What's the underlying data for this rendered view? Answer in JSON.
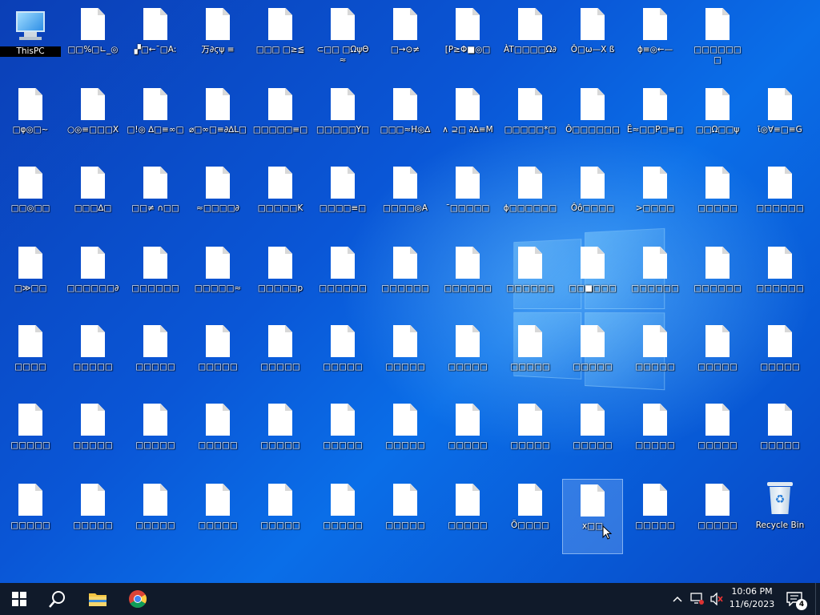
{
  "desktop": {
    "this_pc_label": "ThisPC",
    "recycle_bin_label": "Recycle Bin",
    "file_labels": [
      [
        "□□%□∟_◎",
        "▞□←¯□A:",
        "万∂ϛψ ≡",
        "□□□ □≥≦",
        "⊂□□ □ΩψΘ≈",
        "□→⊙≠",
        "[P≥Φ■◎□",
        "ÀT□□□□Ω∂",
        "Ǒ□ω—X ß",
        "ϕ≡◎←—",
        "□□□□□□ □"
      ],
      [
        "□φ◎□~",
        "○◎≡□□□X",
        "□!◎ ∆□≡∞□",
        "⌀□∞□≡∂∆L□",
        "□□□□□≡□",
        "□□□□□Y□",
        "□□□≈H◎∆",
        "∧ ⊇□ ∂∆≡M",
        "□□□□□*□",
        "Ô□□□□□□",
        "Ē≈□□P□≡□",
        "□□Ω□□ψ",
        "ῑ◎∀≡□≡G"
      ],
      [
        "□□◎□□",
        "□□□∆□",
        "□□≠ ∩□□",
        "≈□□□□∂",
        "□□□□□K",
        "□□□□≡□",
        "□□□□◎A",
        "¯□□□□□",
        "ϕ□□□□□□",
        "Ôô□□□□",
        ">□□□□",
        "□□□□□",
        "□□□□□□"
      ],
      [
        "□≫□□",
        "□□□□□□∂",
        "□□□□□□",
        "□□□□□≈",
        "□□□□□p",
        "□□□□□□",
        "□□□□□□",
        "□□□□□□",
        "□□□□□□",
        "□□■□□□",
        "□□□□□□",
        "□□□□□□",
        "□□□□□□"
      ],
      [
        "□□□□",
        "□□□□□",
        "□□□□□",
        "□□□□□",
        "□□□□□",
        "□□□□□",
        "□□□□□",
        "□□□□□",
        "□□□□□",
        "□□□□□",
        "□□□□□",
        "□□□□□",
        "□□□□□"
      ],
      [
        "□□□□□",
        "□□□□□",
        "□□□□□",
        "□□□□□",
        "□□□□□",
        "□□□□□",
        "□□□□□",
        "□□□□□",
        "□□□□□",
        "□□□□□",
        "□□□□□",
        "□□□□□",
        "□□□□□"
      ],
      [
        "□□□□□",
        "□□□□□",
        "□□□□□",
        "□□□□□",
        "□□□□□",
        "□□□□□",
        "□□□□□",
        "□□□□□",
        "Õ□□□□",
        "x□□",
        "□□□□□",
        "□□□□□"
      ]
    ]
  },
  "taskbar": {
    "start": "start-icon",
    "search": "search-icon",
    "explorer": "folder-icon",
    "chrome": "chrome-icon",
    "time": "10:06 PM",
    "date": "11/6/2023",
    "notification_count": "4"
  }
}
